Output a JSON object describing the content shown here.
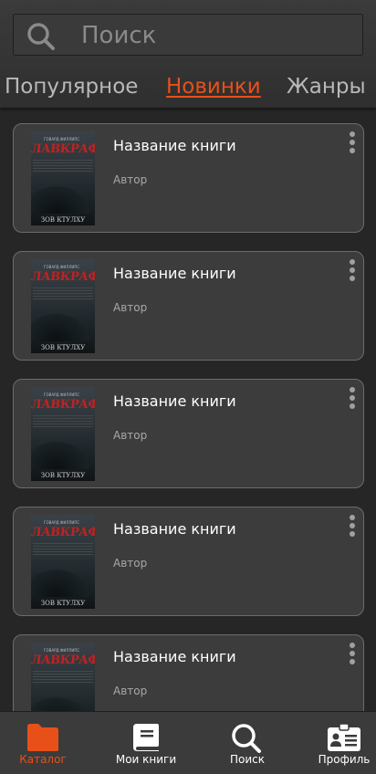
{
  "search": {
    "placeholder": "Поиск"
  },
  "tabs": [
    {
      "label": "Популярное",
      "active": false
    },
    {
      "label": "Новинки",
      "active": true
    },
    {
      "label": "Жанры",
      "active": false
    }
  ],
  "cover": {
    "top": "ГОВАРД ФИЛЛИПС",
    "title": "ЛАВКРАФТ",
    "bottom": "ЗОВ КТУЛХУ"
  },
  "books": [
    {
      "title": "Название книги",
      "author": "Автор"
    },
    {
      "title": "Название книги",
      "author": "Автор"
    },
    {
      "title": "Название книги",
      "author": "Автор"
    },
    {
      "title": "Название книги",
      "author": "Автор"
    },
    {
      "title": "Название книги",
      "author": "Автор"
    }
  ],
  "nav": [
    {
      "label": "Каталог",
      "icon": "folder-icon",
      "active": true
    },
    {
      "label": "Мои книги",
      "icon": "book-icon",
      "active": false
    },
    {
      "label": "Поиск",
      "icon": "search-icon",
      "active": false
    },
    {
      "label": "Профиль",
      "icon": "profile-card-icon",
      "active": false
    }
  ],
  "colors": {
    "accent": "#e8501a",
    "background": "#262626",
    "card": "#3c3c3c"
  }
}
